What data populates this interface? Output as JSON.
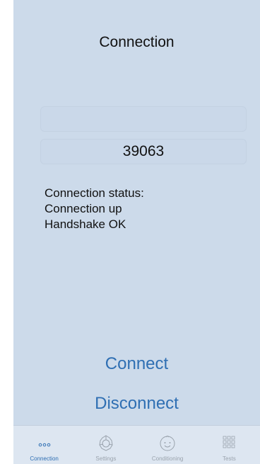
{
  "header": {
    "title": "Connection"
  },
  "fields": {
    "address_value": "",
    "port_value": "39063"
  },
  "status": {
    "label": "Connection status:",
    "connection": "Connection up",
    "handshake": "Handshake OK"
  },
  "actions": {
    "connect_label": "Connect",
    "disconnect_label": "Disconnect"
  },
  "tabs": [
    {
      "label": "Connection",
      "icon": "ellipsis-icon",
      "active": true
    },
    {
      "label": "Settings",
      "icon": "gear-icon",
      "active": false
    },
    {
      "label": "Conditioning",
      "icon": "baby-face-icon",
      "active": false
    },
    {
      "label": "Tests",
      "icon": "grid-icon",
      "active": false
    }
  ],
  "colors": {
    "accent": "#2f6fb3",
    "background": "#ccdaea",
    "inactive": "#9aa3ad"
  }
}
